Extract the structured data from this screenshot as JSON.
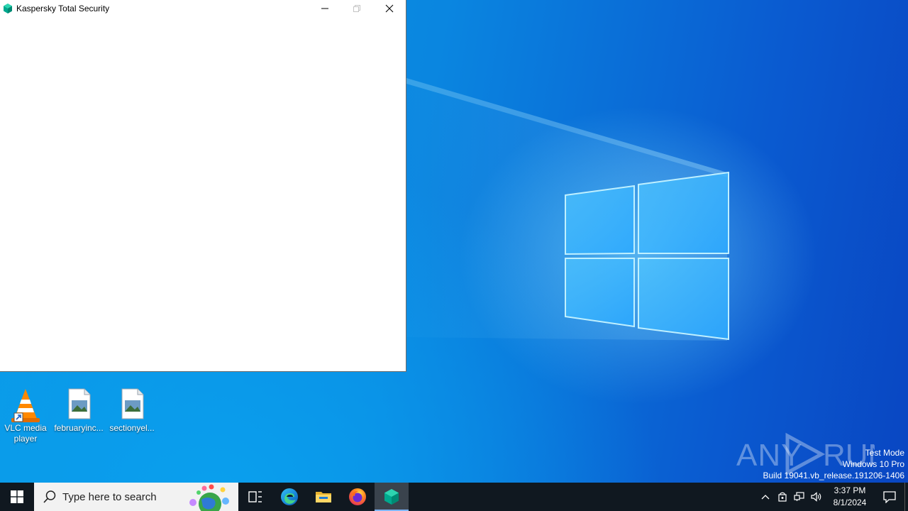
{
  "window": {
    "title": "Kaspersky Total Security",
    "minimize_label": "Minimize",
    "maximize_label": "Maximize",
    "close_label": "Close"
  },
  "desktop": {
    "icons": [
      {
        "label": "VLC media player",
        "icon": "vlc-icon"
      },
      {
        "label": "februaryinc...",
        "icon": "image-file-icon"
      },
      {
        "label": "sectionyel...",
        "icon": "image-file-icon"
      }
    ]
  },
  "watermark": {
    "brand": "ANY RUN",
    "line1": "Test Mode",
    "line2": "Windows 10 Pro",
    "line3": "Build 19041.vb_release.191206-1406"
  },
  "taskbar": {
    "search_placeholder": "Type here to search",
    "apps": [
      "start-icon",
      "task-view-icon",
      "edge-icon",
      "file-explorer-icon",
      "firefox-icon",
      "kaspersky-icon"
    ],
    "time": "3:37 PM",
    "date": "8/1/2024"
  },
  "colors": {
    "taskbar": "#101820",
    "kaspersky_green": "#00a88e",
    "wallpaper_blue": "#0a86e0"
  }
}
